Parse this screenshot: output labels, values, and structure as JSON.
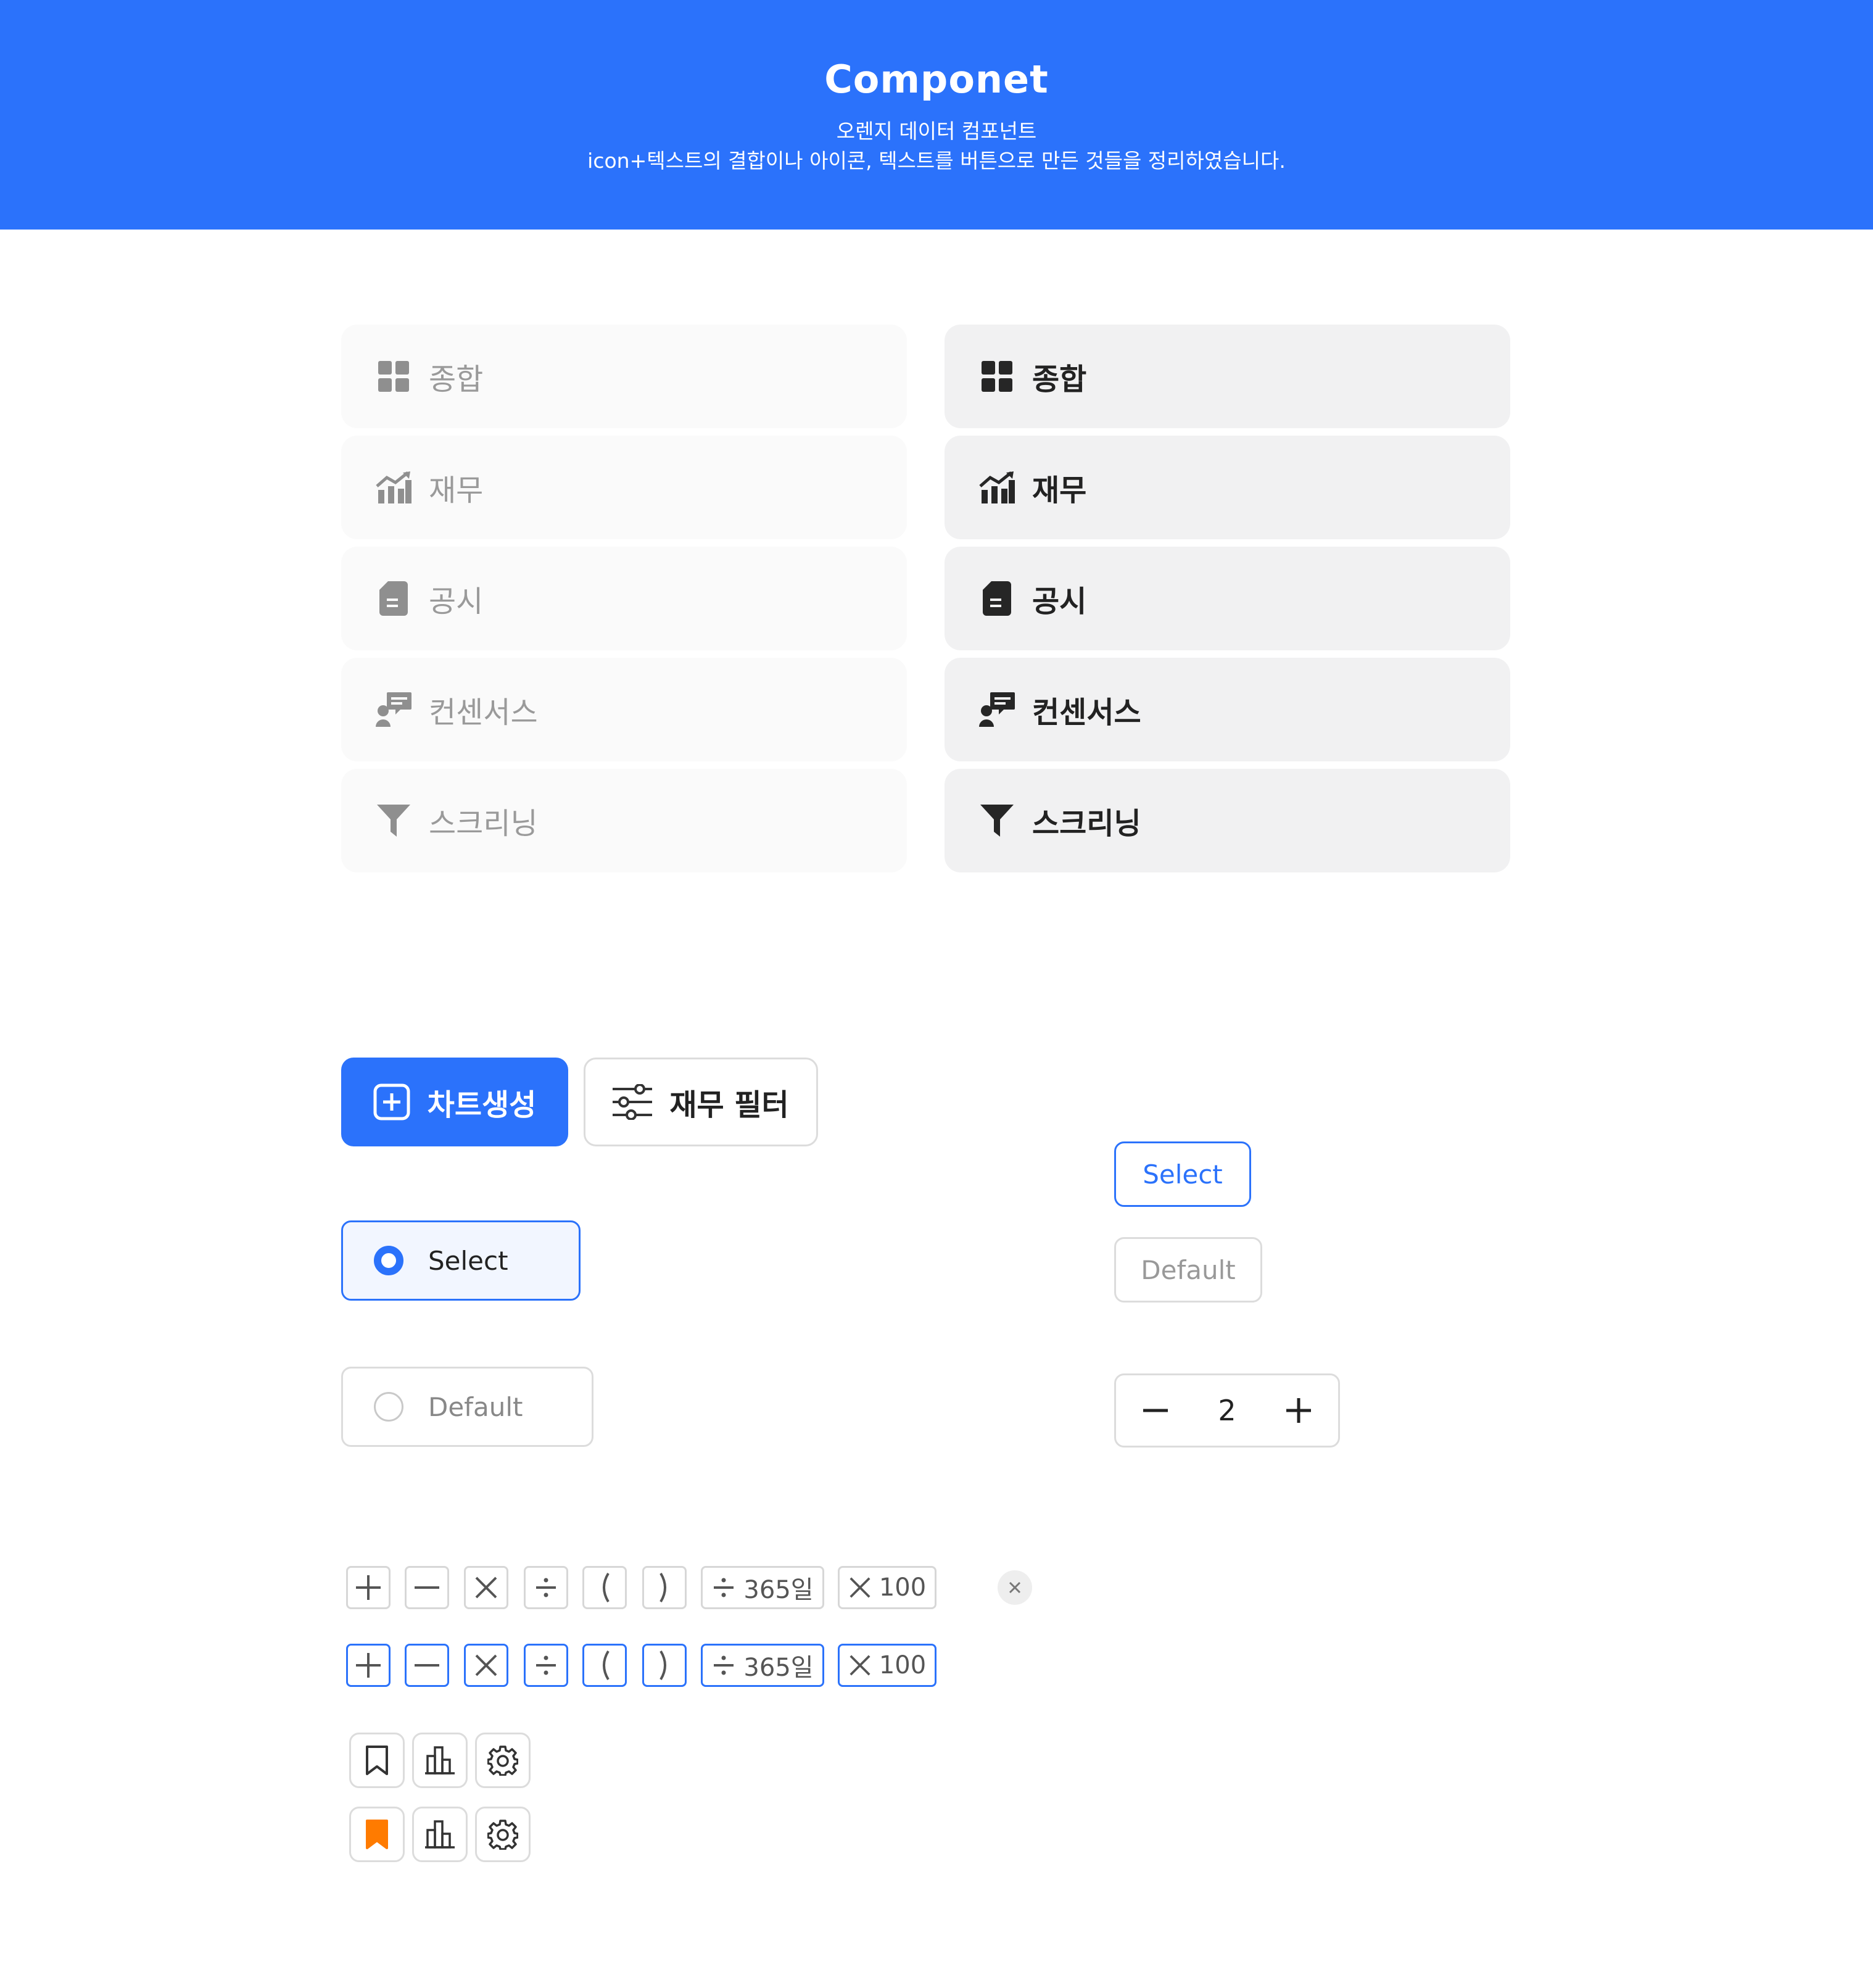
{
  "header": {
    "title": "Componet",
    "subtitle_line1": "오렌지 데이터 컴포넌트",
    "subtitle_line2": "icon+텍스트의 결합이나 아이콘, 텍스트를 버튼으로 만든 것들을 정리하였습니다."
  },
  "menu": {
    "items": [
      {
        "label": "종합",
        "icon": "grid-icon"
      },
      {
        "label": "재무",
        "icon": "chart-icon"
      },
      {
        "label": "공시",
        "icon": "document-icon"
      },
      {
        "label": "컨센서스",
        "icon": "consensus-icon"
      },
      {
        "label": "스크리닝",
        "icon": "funnel-icon"
      }
    ]
  },
  "buttons": {
    "create_chart": "차트생성",
    "finance_filter": "재무 필터"
  },
  "radios": {
    "selected": "Select",
    "default": "Default"
  },
  "chips": {
    "selected": "Select",
    "default": "Default"
  },
  "stepper": {
    "value": "2"
  },
  "operators": {
    "divide_days": "365일",
    "multiply_value": "100"
  },
  "colors": {
    "primary": "#2b72fb",
    "bookmark_active": "#ff7b00"
  }
}
